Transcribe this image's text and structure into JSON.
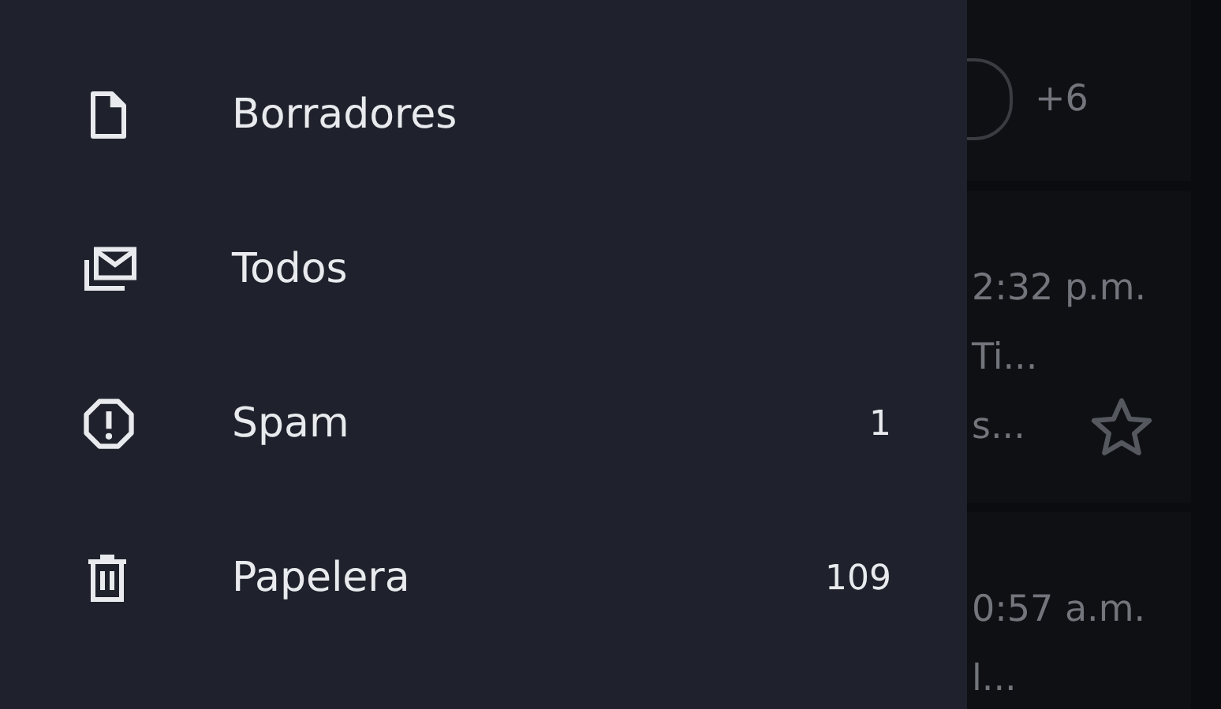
{
  "drawer": {
    "items": [
      {
        "kind": "draft",
        "label": "Borradores"
      },
      {
        "kind": "all",
        "label": "Todos"
      },
      {
        "kind": "spam",
        "label": "Spam",
        "count": "1"
      },
      {
        "kind": "trash",
        "label": "Papelera",
        "count": "109"
      }
    ]
  },
  "mail_list": {
    "cards": [
      {
        "extra": "+6"
      },
      {
        "time": "2:32 p.m.",
        "line_1": "Ti...",
        "line_2": "s...",
        "starred": false
      },
      {
        "time": "0:57 a.m.",
        "line_1": "l..."
      }
    ]
  }
}
